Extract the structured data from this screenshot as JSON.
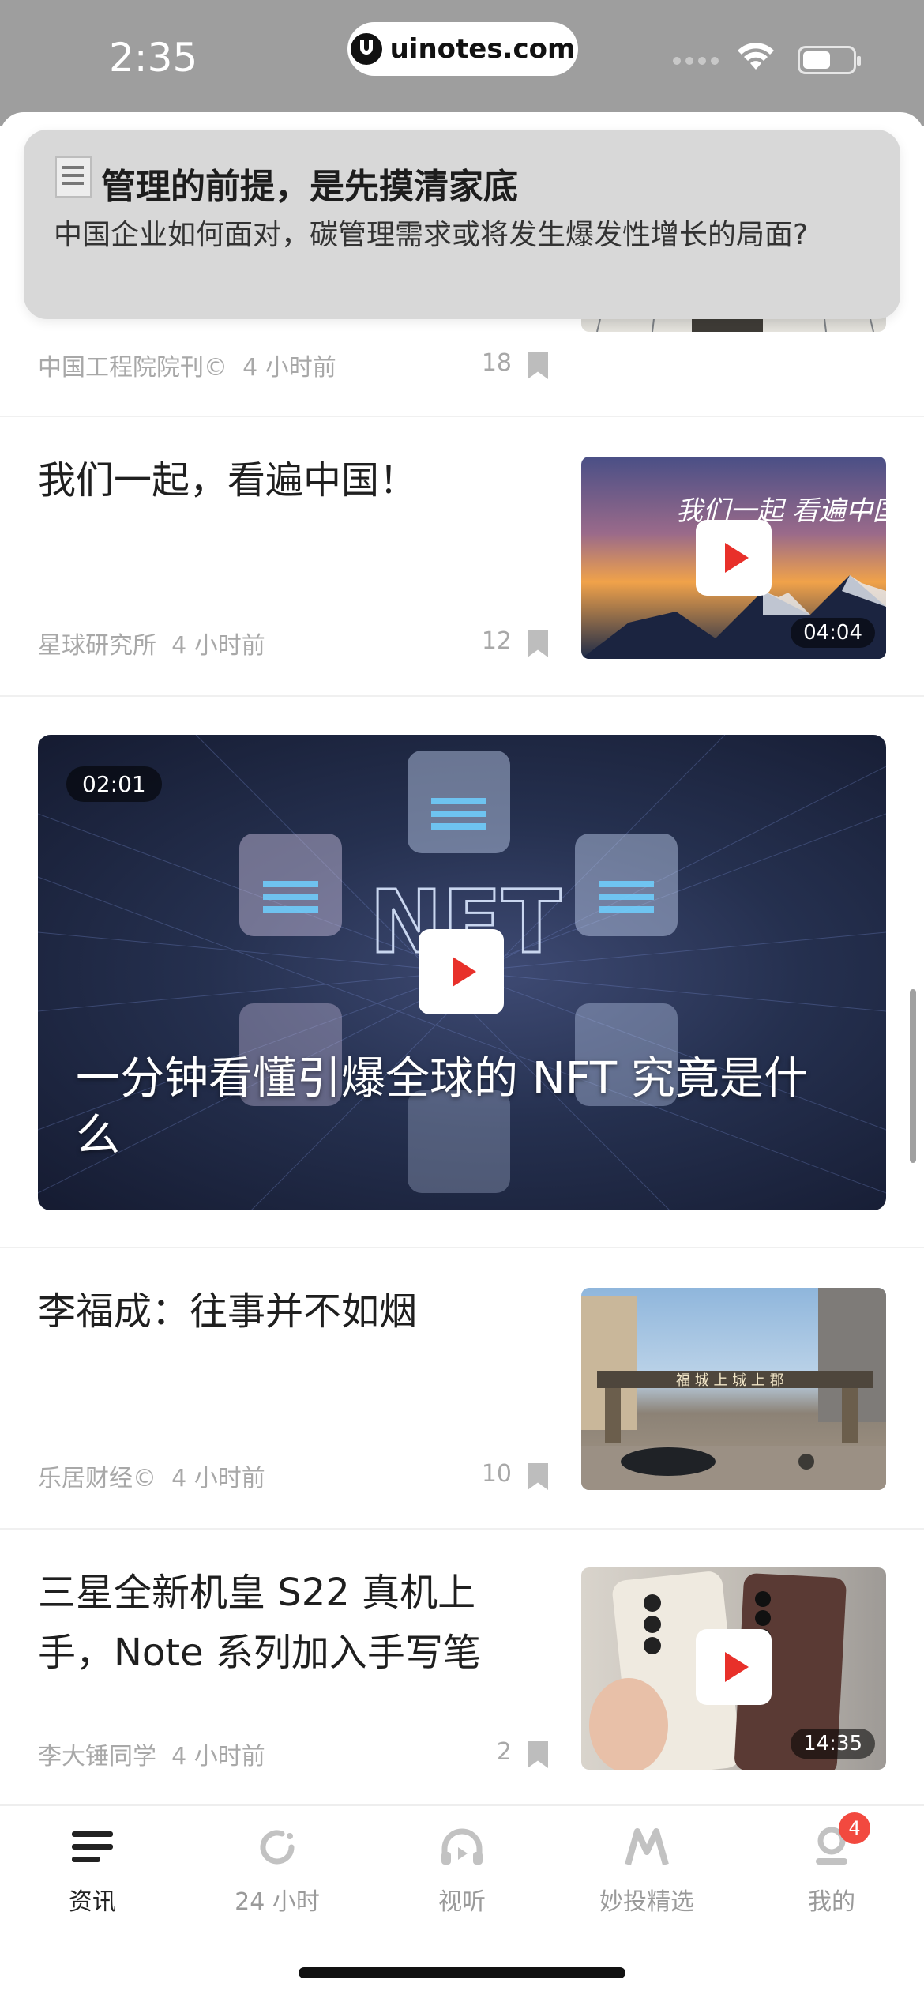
{
  "status_bar": {
    "time": "2:35",
    "url": "uinotes.com"
  },
  "banner": {
    "title": "管理的前提，是先摸清家底",
    "body": "中国企业如何面对，碳管理需求或将发生爆发性增长的局面?"
  },
  "articles": [
    {
      "source": "中国工程院院刊©",
      "time": "4 小时前",
      "count": "18"
    },
    {
      "title": "我们一起，看遍中国！",
      "source": "星球研究所",
      "time": "4 小时前",
      "count": "12",
      "duration": "04:04"
    },
    {
      "title": "李福成：往事并不如烟",
      "source": "乐居财经©",
      "time": "4 小时前",
      "count": "10"
    },
    {
      "title": "三星全新机皇 S22 真机上手，Note 系列加入手写笔",
      "source": "李大锤同学",
      "time": "4 小时前",
      "count": "2",
      "duration": "14:35"
    }
  ],
  "featured_video": {
    "duration": "02:01",
    "title": "一分钟看懂引爆全球的 NFT 究竟是什么",
    "overlay_text": "NFT"
  },
  "thumb_text": {
    "trip": "我们一起 看遍中国",
    "gate": "福 城 上 城 上 郡"
  },
  "tabbar": {
    "tabs": [
      {
        "label": "资讯",
        "icon": "news-icon",
        "active": true
      },
      {
        "label": "24 小时",
        "icon": "refresh-24h-icon",
        "active": false
      },
      {
        "label": "视听",
        "icon": "headphones-icon",
        "active": false
      },
      {
        "label": "妙投精选",
        "icon": "m-logo-icon",
        "active": false
      },
      {
        "label": "我的",
        "icon": "profile-icon",
        "active": false
      }
    ],
    "badge": "4"
  },
  "colors": {
    "accent_red": "#e8302a",
    "badge_red": "#f2493f",
    "active_text": "#222222",
    "inactive_text": "#9a9a9a"
  }
}
